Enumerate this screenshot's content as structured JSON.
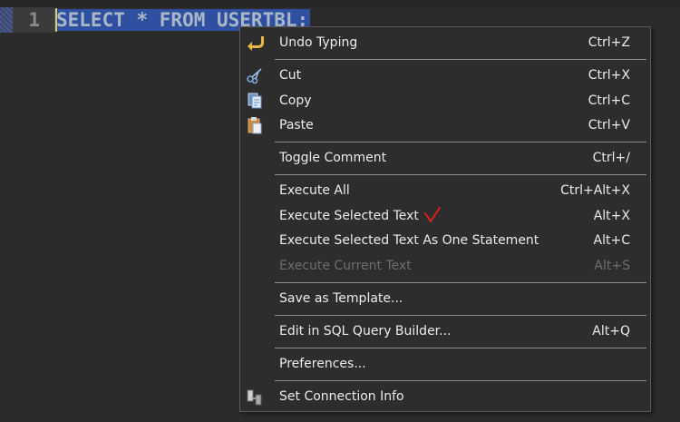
{
  "editor": {
    "line_number": "1",
    "code_text": "SELECT * FROM USERTBL;"
  },
  "menu": {
    "items": [
      {
        "label": "Undo Typing",
        "shortcut": "Ctrl+Z",
        "icon": "undo-icon",
        "enabled": true
      },
      {
        "label": "Cut",
        "shortcut": "Ctrl+X",
        "icon": "scissors-icon",
        "enabled": true
      },
      {
        "label": "Copy",
        "shortcut": "Ctrl+C",
        "icon": "copy-icon",
        "enabled": true
      },
      {
        "label": "Paste",
        "shortcut": "Ctrl+V",
        "icon": "paste-icon",
        "enabled": true
      },
      {
        "label": "Toggle Comment",
        "shortcut": "Ctrl+/",
        "icon": "",
        "enabled": true
      },
      {
        "label": "Execute All",
        "shortcut": "Ctrl+Alt+X",
        "icon": "",
        "enabled": true
      },
      {
        "label": "Execute Selected Text",
        "shortcut": "Alt+X",
        "icon": "",
        "enabled": true,
        "annotation": "red-checkmark"
      },
      {
        "label": "Execute Selected Text As One Statement",
        "shortcut": "Alt+C",
        "icon": "",
        "enabled": true
      },
      {
        "label": "Execute Current Text",
        "shortcut": "Alt+S",
        "icon": "",
        "enabled": false
      },
      {
        "label": "Save as Template...",
        "shortcut": "",
        "icon": "",
        "enabled": true
      },
      {
        "label": "Edit in SQL Query Builder...",
        "shortcut": "Alt+Q",
        "icon": "",
        "enabled": true
      },
      {
        "label": "Preferences...",
        "shortcut": "",
        "icon": "",
        "enabled": true
      },
      {
        "label": "Set Connection Info",
        "shortcut": "",
        "icon": "connection-icon",
        "enabled": true
      }
    ]
  },
  "colors": {
    "editor_bg": "#2b2b2b",
    "selection": "#2f4fa1",
    "menu_bg": "#2d2d2d",
    "menu_text": "#ececec",
    "disabled_text": "#6e6e6e",
    "check_mark": "#e02020"
  }
}
